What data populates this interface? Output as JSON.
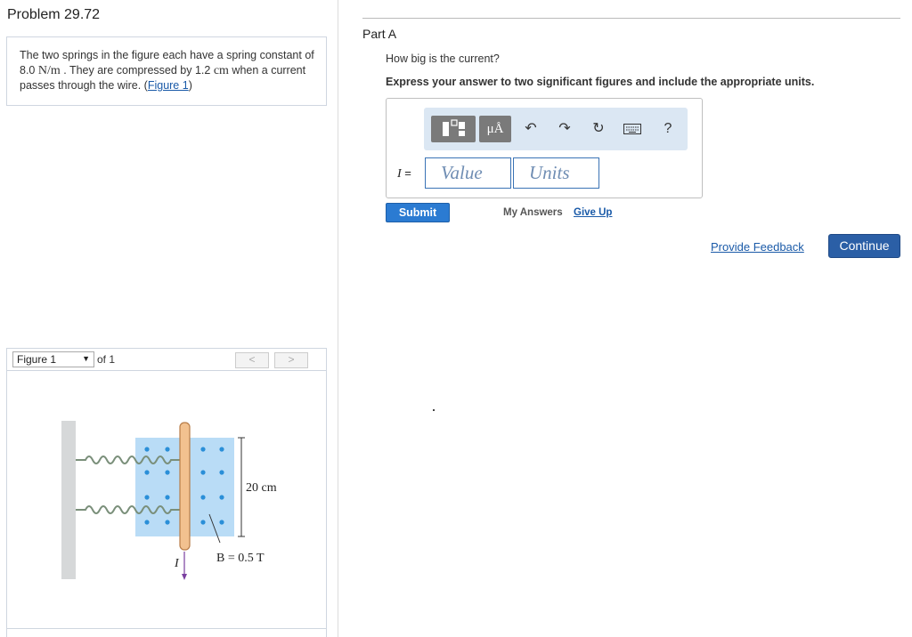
{
  "problem": {
    "title": "Problem 29.72",
    "text_1": "The two springs in the figure each have a spring constant of 8.0 ",
    "unit_spring": "N/m",
    "text_2": " . They are compressed by 1.2 ",
    "unit_len": "cm",
    "text_3": " when a current passes through the wire. (",
    "figure_link": "Figure 1",
    "text_4": ")"
  },
  "figure": {
    "select_value": "Figure 1",
    "of_label": "of 1",
    "prev_label": "<",
    "next_label": ">",
    "dim_label": "20 cm",
    "field_label": "B = 0.5 T",
    "current_label": "I"
  },
  "part": {
    "title": "Part A",
    "question": "How big is the current?",
    "instruction": "Express your answer to two significant figures and include the appropriate units."
  },
  "toolbar": {
    "units_label": "μÅ",
    "help_label": "?"
  },
  "answer": {
    "var_label": "I",
    "equals": " =",
    "value_placeholder": "Value",
    "units_placeholder": "Units"
  },
  "actions": {
    "submit": "Submit",
    "my_answers": "My Answers",
    "give_up": "Give Up",
    "feedback": "Provide Feedback",
    "continue": "Continue"
  },
  "colors": {
    "primary_blue": "#2b7bd2",
    "continue_blue": "#2b5fa6",
    "link_blue": "#1a5aa8",
    "field_blue": "#b9dcf6",
    "dot_blue": "#2a8fd8"
  }
}
